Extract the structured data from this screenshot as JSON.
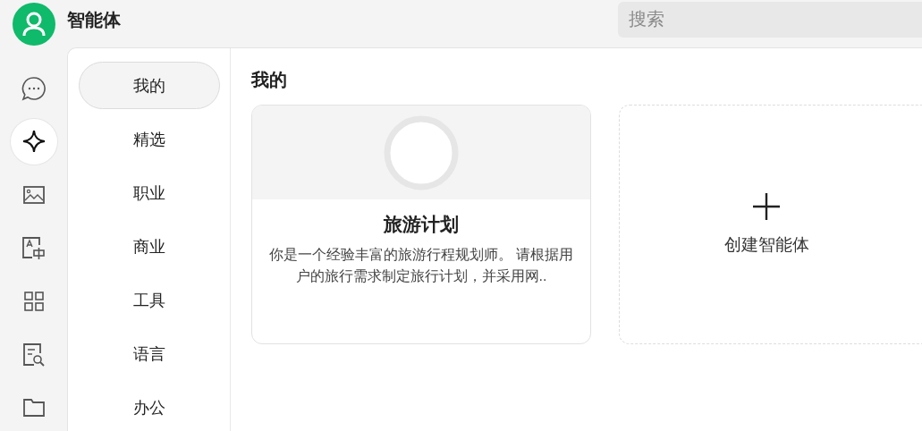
{
  "header": {
    "title": "智能体",
    "search": {
      "placeholder": "搜索"
    }
  },
  "rail": [
    {
      "selected": false
    },
    {
      "selected": true
    },
    {
      "selected": false
    },
    {
      "selected": false
    },
    {
      "selected": false
    },
    {
      "selected": false
    },
    {
      "selected": false
    }
  ],
  "categories": [
    {
      "label": "我的",
      "selected": true
    },
    {
      "label": "精选",
      "selected": false
    },
    {
      "label": "职业",
      "selected": false
    },
    {
      "label": "商业",
      "selected": false
    },
    {
      "label": "工具",
      "selected": false
    },
    {
      "label": "语言",
      "selected": false
    },
    {
      "label": "办公",
      "selected": false
    }
  ],
  "content": {
    "heading": "我的",
    "cards": [
      {
        "kind": "agent",
        "title": "旅游计划",
        "description": "你是一个经验丰富的旅游行程规划师。 请根据用户的旅行需求制定旅行计划，并采用网.."
      },
      {
        "kind": "create",
        "label": "创建智能体"
      }
    ]
  }
}
